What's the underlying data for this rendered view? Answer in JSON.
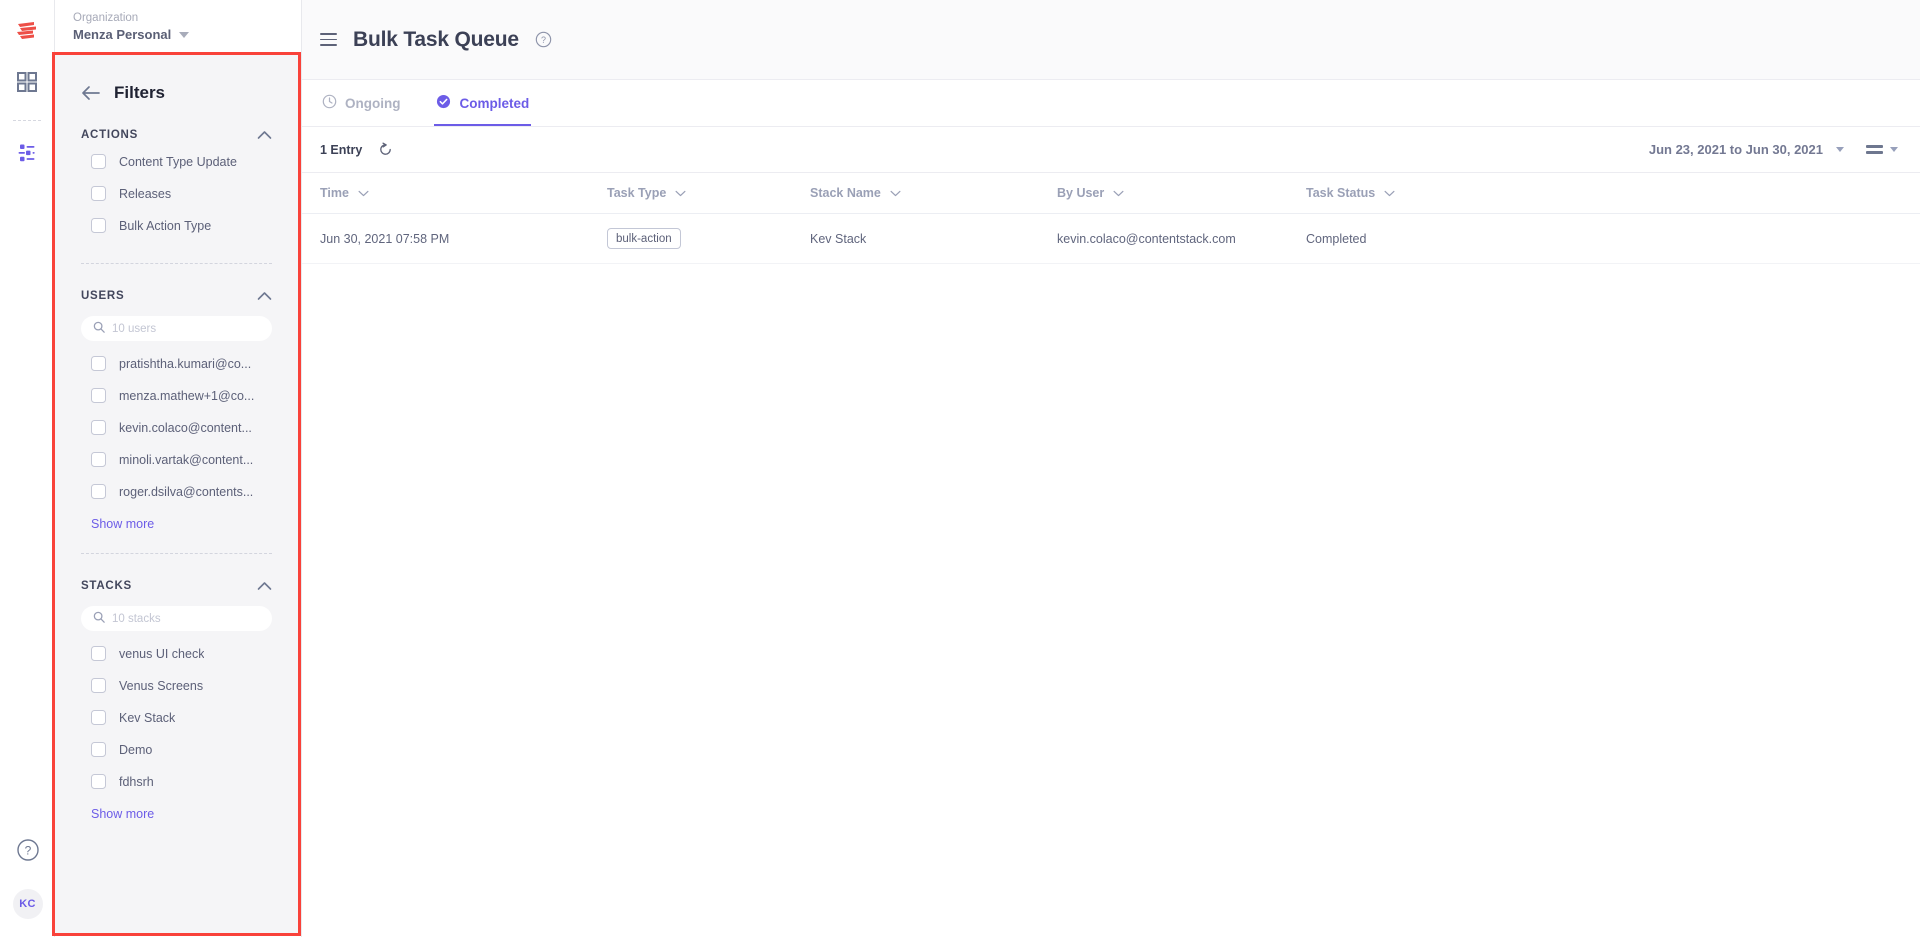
{
  "rail": {
    "logo_icon": "contentstack-logo",
    "items": [
      {
        "icon": "grid-icon",
        "name": "dashboard",
        "active": false
      },
      {
        "icon": "sliders-icon",
        "name": "bulk-task-queue",
        "active": true
      }
    ],
    "help_icon": "question-circle-icon",
    "avatar_initials": "KC"
  },
  "org": {
    "label": "Organization",
    "name": "Menza Personal",
    "caret_icon": "caret-down-icon"
  },
  "sidebar": {
    "back_icon": "arrow-left-icon",
    "title": "Filters",
    "highlight_color": "#f9423a",
    "sections": [
      {
        "id": "actions",
        "title": "ACTIONS",
        "collapse_icon": "chevron-up-icon",
        "search": null,
        "items": [
          {
            "label": "Content Type Update",
            "checked": false
          },
          {
            "label": "Releases",
            "checked": false
          },
          {
            "label": "Bulk Action Type",
            "checked": false
          }
        ],
        "show_more": null
      },
      {
        "id": "users",
        "title": "USERS",
        "collapse_icon": "chevron-up-icon",
        "search": {
          "placeholder": "10 users",
          "value": "",
          "icon": "search-icon"
        },
        "items": [
          {
            "label": "pratishtha.kumari@co...",
            "checked": false
          },
          {
            "label": "menza.mathew+1@co...",
            "checked": false
          },
          {
            "label": "kevin.colaco@content...",
            "checked": false
          },
          {
            "label": "minoli.vartak@content...",
            "checked": false
          },
          {
            "label": "roger.dsilva@contents...",
            "checked": false
          }
        ],
        "show_more": "Show more"
      },
      {
        "id": "stacks",
        "title": "STACKS",
        "collapse_icon": "chevron-up-icon",
        "search": {
          "placeholder": "10 stacks",
          "value": "",
          "icon": "search-icon"
        },
        "items": [
          {
            "label": "venus UI check",
            "checked": false
          },
          {
            "label": "Venus Screens",
            "checked": false
          },
          {
            "label": "Kev Stack",
            "checked": false
          },
          {
            "label": "Demo",
            "checked": false
          },
          {
            "label": "fdhsrh",
            "checked": false
          }
        ],
        "show_more": "Show more"
      }
    ]
  },
  "header": {
    "menu_icon": "hamburger-icon",
    "title": "Bulk Task Queue",
    "help_icon": "question-circle-icon"
  },
  "tabs": [
    {
      "label": "Ongoing",
      "icon": "clock-icon",
      "active": false
    },
    {
      "label": "Completed",
      "icon": "check-circle-icon",
      "active": true
    }
  ],
  "subbar": {
    "entry_count": "1 Entry",
    "refresh_icon": "refresh-icon",
    "date_range": "Jun 23, 2021 to Jun 30, 2021",
    "date_caret_icon": "caret-down-icon",
    "view_icon": "list-view-icon",
    "view_caret_icon": "caret-down-icon"
  },
  "table": {
    "columns": [
      {
        "label": "Time",
        "sort_icon": "chevron-down-icon"
      },
      {
        "label": "Task Type",
        "sort_icon": "chevron-down-icon"
      },
      {
        "label": "Stack Name",
        "sort_icon": "chevron-down-icon"
      },
      {
        "label": "By User",
        "sort_icon": "chevron-down-icon"
      },
      {
        "label": "Task Status",
        "sort_icon": "chevron-down-icon"
      }
    ],
    "rows": [
      {
        "time": "Jun 30, 2021 07:58 PM",
        "task_type": "bulk-action",
        "stack_name": "Kev Stack",
        "by_user": "kevin.colaco@contentstack.com",
        "task_status": "Completed"
      }
    ]
  },
  "colors": {
    "accent": "#6c5ce7",
    "highlight": "#f9423a",
    "text": "#5c6078",
    "muted": "#9aa0b6"
  }
}
